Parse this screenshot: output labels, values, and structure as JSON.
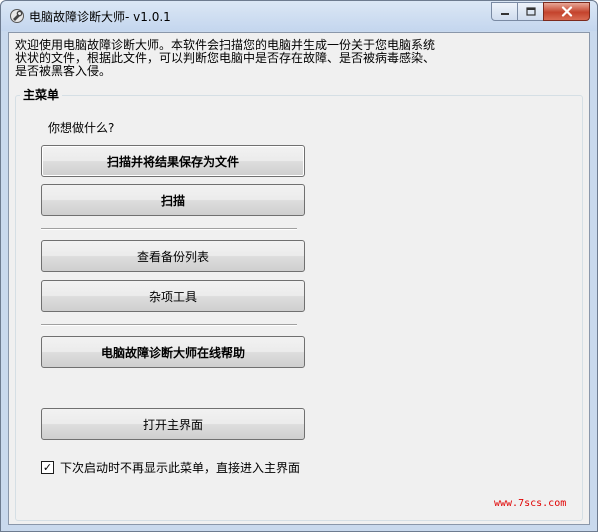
{
  "window": {
    "title": "电脑故障诊断大师- v1.0.1",
    "controls": {
      "minimize": "minimize",
      "maximize": "maximize",
      "close": "close"
    }
  },
  "intro_text": "欢迎使用电脑故障诊断大师。本软件会扫描您的电脑并生成一份关于您电脑系统状状的文件，根据此文件，可以判断您电脑中是否存在故障、是否被病毒感染、是否被黑客入侵。",
  "main_menu": {
    "label": "主菜单",
    "prompt": "你想做什么?",
    "buttons": {
      "scan_save": "扫描并将结果保存为文件",
      "scan": "扫描",
      "backup_list": "查看备份列表",
      "misc_tools": "杂项工具",
      "online_help": "电脑故障诊断大师在线帮助",
      "open_main": "打开主界面"
    },
    "checkbox": {
      "label": "下次启动时不再显示此菜单，直接进入主界面",
      "checked": true,
      "mark": "✓"
    }
  },
  "watermark": "www.7scs.com"
}
